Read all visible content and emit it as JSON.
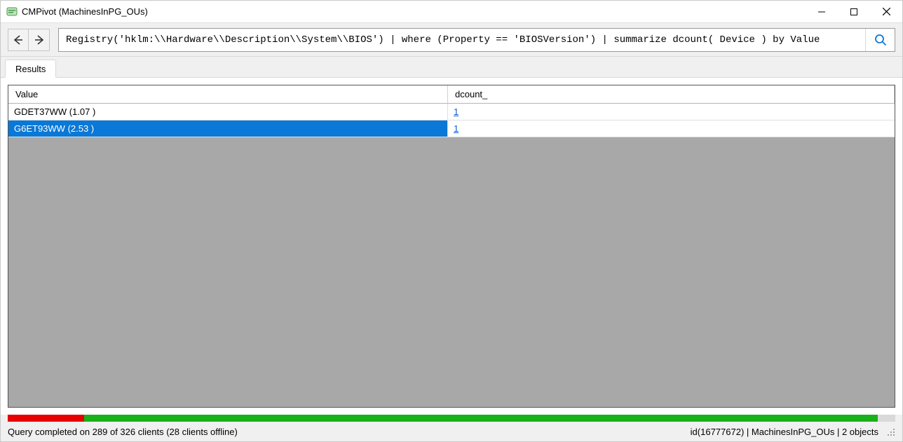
{
  "window": {
    "title": "CMPivot (MachinesInPG_OUs)"
  },
  "toolbar": {
    "query": "Registry('hklm:\\\\Hardware\\\\Description\\\\System\\\\BIOS') | where (Property == 'BIOSVersion') | summarize dcount( Device ) by Value"
  },
  "tabs": {
    "results": "Results"
  },
  "grid": {
    "columns": {
      "value": "Value",
      "dcount": "dcount_"
    },
    "rows": [
      {
        "value": "GDET37WW (1.07 )",
        "dcount": "1",
        "selected": false
      },
      {
        "value": "G6ET93WW (2.53 )",
        "dcount": "1",
        "selected": true
      }
    ]
  },
  "progress": {
    "red_pct": 8.6,
    "green_pct": 89.4,
    "gray_pct": 2.0
  },
  "status": {
    "left": "Query completed on 289 of 326 clients (28 clients offline)",
    "right": "id(16777672)  |  MachinesInPG_OUs  |  2 objects"
  }
}
